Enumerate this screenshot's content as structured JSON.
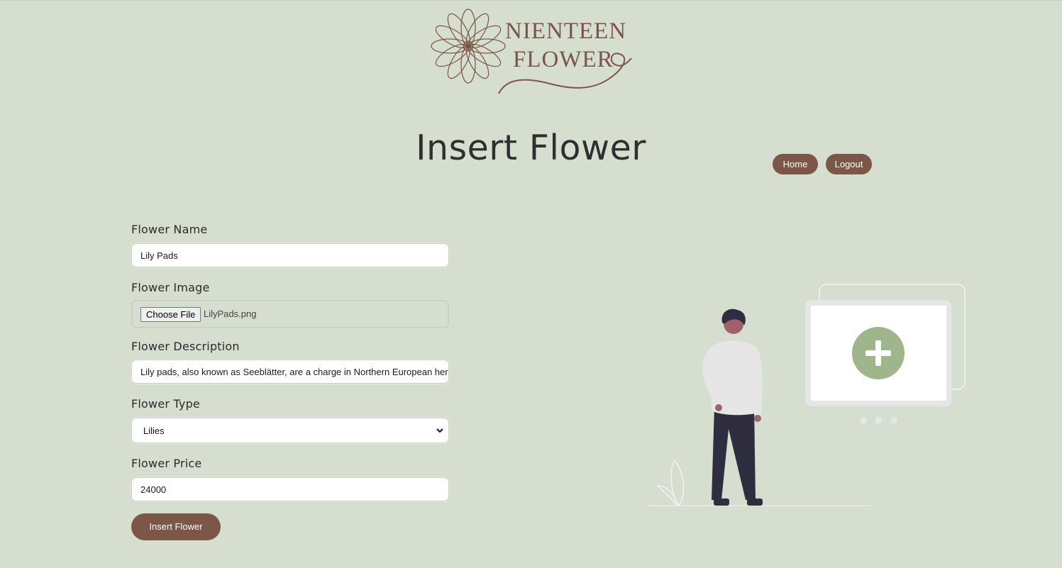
{
  "brand": {
    "logo_line1": "NIENTEEN",
    "logo_line2": "FLOWER"
  },
  "header": {
    "title": "Insert Flower"
  },
  "nav": {
    "home_label": "Home",
    "logout_label": "Logout"
  },
  "form": {
    "name": {
      "label": "Flower Name",
      "value": "Lily Pads"
    },
    "image": {
      "label": "Flower Image",
      "button_label": "Choose File",
      "file_name": "LilyPads.png"
    },
    "description": {
      "label": "Flower Description",
      "value": "Lily pads, also known as Seeblätter, are a charge in Northern European heraldry"
    },
    "type": {
      "label": "Flower Type",
      "selected": "Lilies"
    },
    "price": {
      "label": "Flower Price",
      "value": "24000"
    },
    "submit_label": "Insert Flower"
  },
  "colors": {
    "background": "#d6dfcf",
    "accent": "#7c5647",
    "plus_circle": "#9fb58c"
  },
  "icons": {
    "logo": "flower-mandala-icon",
    "select_arrow": "chevron-down-icon",
    "add": "plus-icon"
  }
}
